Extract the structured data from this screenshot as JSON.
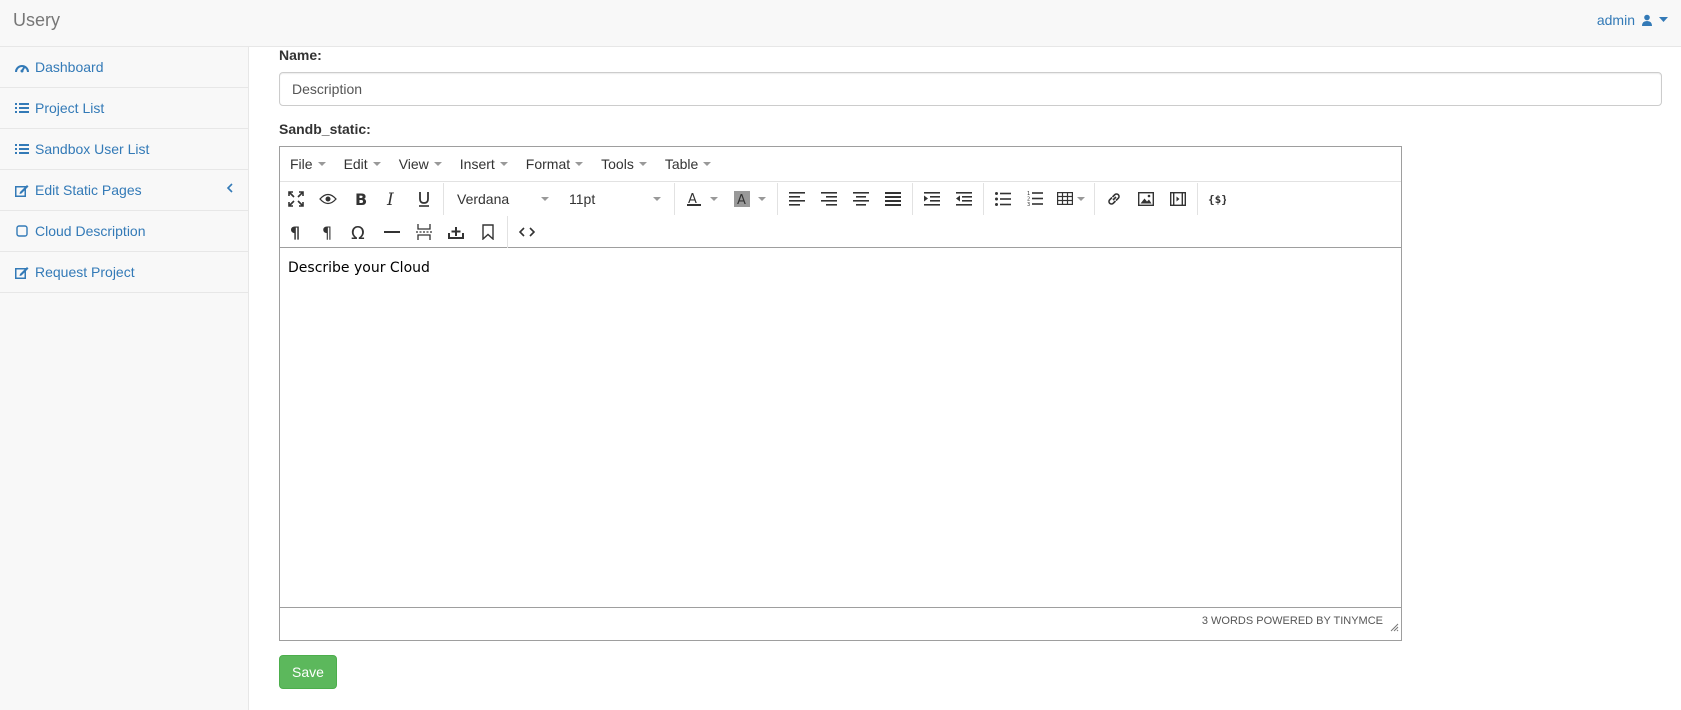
{
  "navbar": {
    "brand": "Usery",
    "user": "admin"
  },
  "sidebar": {
    "items": [
      {
        "label": "Dashboard",
        "icon": "dashboard-icon"
      },
      {
        "label": "Project List",
        "icon": "list-icon"
      },
      {
        "label": "Sandbox User List",
        "icon": "list-icon"
      },
      {
        "label": "Edit Static Pages",
        "icon": "edit-icon"
      },
      {
        "label": "Cloud Description",
        "icon": "square-icon"
      },
      {
        "label": "Request Project",
        "icon": "edit-icon"
      }
    ]
  },
  "form": {
    "name_label": "Name:",
    "name_value": "Description",
    "sandb_label": "Sandb_static:",
    "save_label": "Save"
  },
  "editor": {
    "menus": [
      "File",
      "Edit",
      "View",
      "Insert",
      "Format",
      "Tools",
      "Table"
    ],
    "font_family": "Verdana",
    "font_size": "11pt",
    "content": "Describe your Cloud",
    "status": "3 WORDS POWERED BY TINYMCE"
  },
  "colors": {
    "link": "#337ab7",
    "save": "#5cb85c"
  }
}
